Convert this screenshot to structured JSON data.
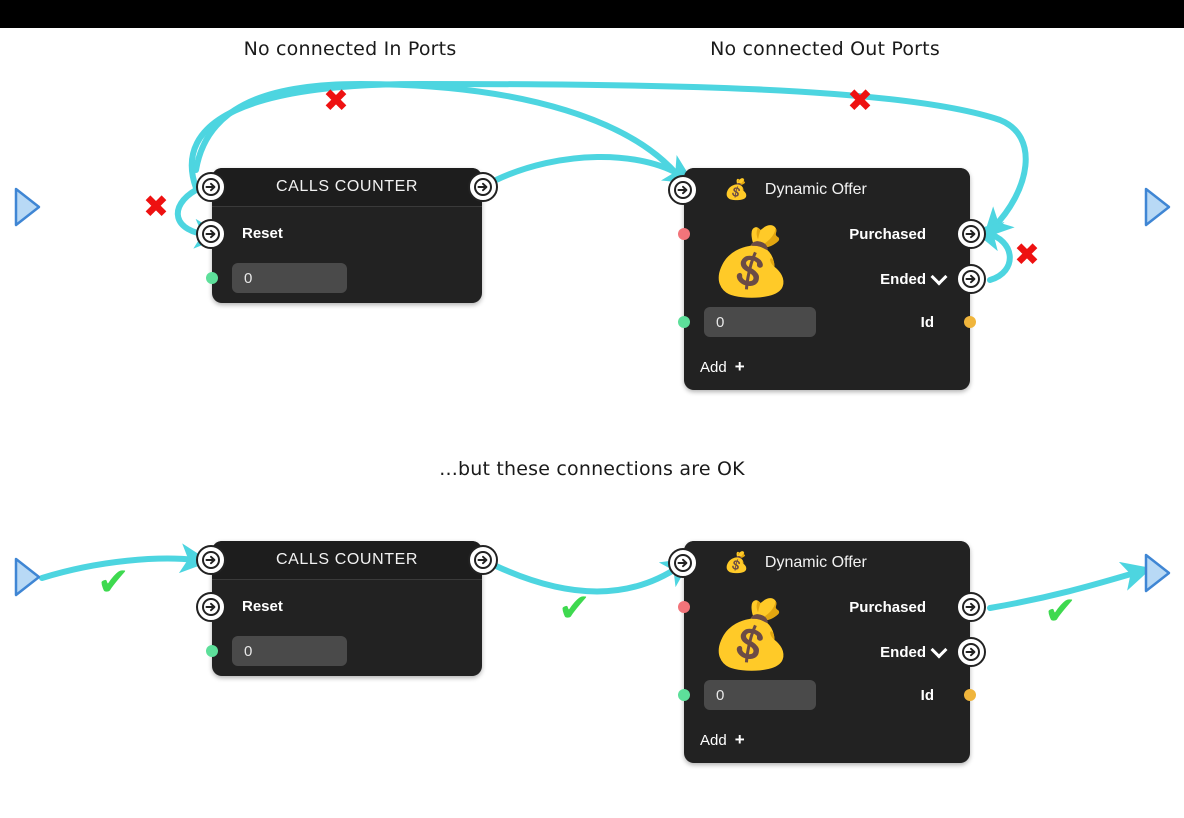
{
  "theme": {
    "background": "#ffffff",
    "topbar": "#000000",
    "node_bg": "#222222",
    "node_header_bg": "#1d1d1d",
    "edge_cyan": "#4dd5e0",
    "mark_red": "#ee1111",
    "mark_green": "#3ed94f",
    "port_white": "#ffffff",
    "field_bg": "#4a4a4a",
    "dot_green": "#5ddf9a",
    "dot_red": "#f2747a",
    "dot_orange": "#f0b53c",
    "triangle_fill": "#b8d9f5",
    "triangle_stroke": "#3f86d4"
  },
  "captions": {
    "top_left": "No connected In Ports",
    "top_right": "No connected Out Ports",
    "middle": "...but these connections are OK"
  },
  "marks": {
    "x_symbol": "✖",
    "check_symbol": "✔",
    "invalid": [
      {
        "id": "x-top-left",
        "label": "invalid-connection"
      },
      {
        "id": "x-top-right",
        "label": "invalid-connection"
      },
      {
        "id": "x-left-loop",
        "label": "invalid-connection"
      },
      {
        "id": "x-right-loop",
        "label": "invalid-connection"
      }
    ],
    "valid": [
      {
        "id": "check-input",
        "label": "valid-connection"
      },
      {
        "id": "check-middle",
        "label": "valid-connection"
      },
      {
        "id": "check-output",
        "label": "valid-connection"
      }
    ]
  },
  "nodes": {
    "calls_counter_invalid": {
      "title": "CALLS COUNTER",
      "reset_label": "Reset",
      "counter_value": "0",
      "in_port_name": "in-port",
      "out_port_name": "out-port",
      "reset_port_name": "reset-in-port"
    },
    "calls_counter_valid": {
      "title": "CALLS COUNTER",
      "reset_label": "Reset",
      "counter_value": "0"
    },
    "dynamic_offer_invalid": {
      "title": "Dynamic Offer",
      "header_icon": "💰",
      "body_icon": "💰",
      "chevron": "chevron-down",
      "out_ports": [
        "Purchased",
        "Ended"
      ],
      "id_label": "Id",
      "value": "0",
      "add_label": "Add",
      "add_plus": "+"
    },
    "dynamic_offer_valid": {
      "title": "Dynamic Offer",
      "header_icon": "💰",
      "body_icon": "💰",
      "chevron": "chevron-down",
      "out_ports": [
        "Purchased",
        "Ended"
      ],
      "id_label": "Id",
      "value": "0",
      "add_label": "Add",
      "add_plus": "+"
    }
  },
  "markers": {
    "left_top": "flow-start-marker",
    "right_top": "flow-end-marker",
    "left_bottom": "flow-start-marker",
    "right_bottom": "flow-end-marker"
  }
}
